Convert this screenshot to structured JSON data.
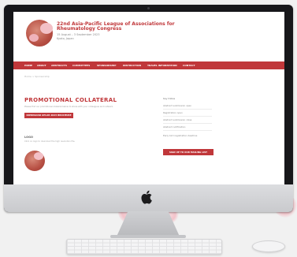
{
  "website": {
    "title": "22nd Asia-Pacific League of Associations for Rheumatology Congress",
    "dates": "15 August – 3 September 2023",
    "location": "Kyoto, Japan",
    "nav": [
      "HOME",
      "ABOUT",
      "ABSTRACTS",
      "COMMITTEES",
      "SPONSORSHIP",
      "INSTRUCTION",
      "TRAVEL INFORMATION",
      "CONTACT"
    ],
    "breadcrumb": "Home > Sponsorship",
    "page_heading": "PROMOTIONAL COLLATERAL",
    "page_text": "Please find our promotional material below to share with your colleagues and network.",
    "download_button": "DOWNLOAD APLAR 2023 BROCHURE",
    "logos_heading": "LOGO",
    "logos_text": "Click on logo to download the high resolution file.",
    "sidebar_title": "Key Dates",
    "sidebar_links": [
      "Abstract submission open",
      "Registration open",
      "Abstract submission close",
      "Abstract notification",
      "Early bird registration deadline"
    ],
    "mailing_button": "SIGN UP TO OUR MAILING LIST"
  },
  "colors": {
    "brand": "#c0373a",
    "monitor": "#17171a"
  },
  "icons": [
    "apple-logo-icon"
  ]
}
